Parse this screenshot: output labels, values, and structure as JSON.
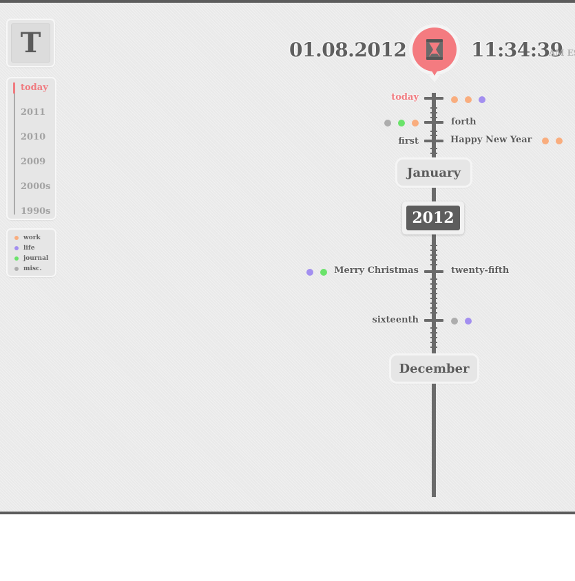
{
  "logo": {
    "letter": "T"
  },
  "nav": {
    "items": [
      {
        "label": "today",
        "active": true
      },
      {
        "label": "2011",
        "active": false
      },
      {
        "label": "2010",
        "active": false
      },
      {
        "label": "2009",
        "active": false
      },
      {
        "label": "2000s",
        "active": false
      },
      {
        "label": "1990s",
        "active": false
      }
    ]
  },
  "legend": {
    "items": [
      {
        "label": "work",
        "color": "#f9ad7e"
      },
      {
        "label": "life",
        "color": "#a38ff0"
      },
      {
        "label": "journal",
        "color": "#6ae36a"
      },
      {
        "label": "misc.",
        "color": "#adadad"
      }
    ]
  },
  "header": {
    "date": "01.08.2012",
    "time": "11:34:39",
    "ampm": "AM EST",
    "pin_icon": "hourglass-icon",
    "pin_color": "#f47b80"
  },
  "timeline": {
    "events": [
      {
        "left_label": "today",
        "right_label": "",
        "dots_left": [],
        "dots_right": [
          "#f9ad7e",
          "#f9ad7e",
          "#a38ff0"
        ]
      },
      {
        "left_label": "",
        "right_label": "forth",
        "dots_left": [
          "#adadad",
          "#6ae36a",
          "#f9ad7e"
        ],
        "dots_right": []
      },
      {
        "left_label": "first",
        "right_label": "Happy New Year",
        "dots_left": [],
        "dots_right": [
          "#f9ad7e",
          "#f9ad7e"
        ]
      },
      {
        "left_label": "Merry Christmas",
        "right_label": "twenty-fifth",
        "dots_left": [
          "#a38ff0",
          "#6ae36a"
        ],
        "dots_right": []
      },
      {
        "left_label": "sixteenth",
        "right_label": "",
        "dots_left": [],
        "dots_right": [
          "#adadad",
          "#a38ff0"
        ]
      }
    ],
    "month_top": "January",
    "year": "2012",
    "month_bottom": "December"
  }
}
